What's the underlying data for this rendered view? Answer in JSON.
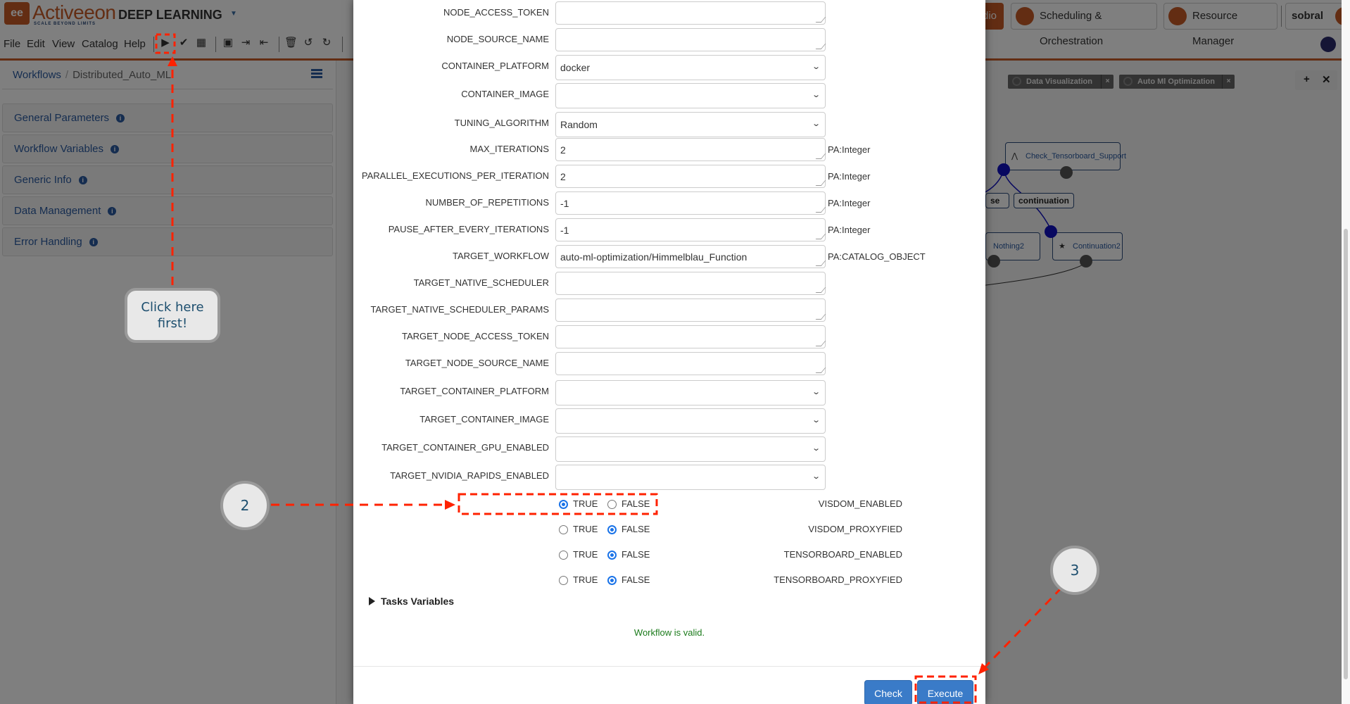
{
  "header": {
    "brand": "Activeeon",
    "brand_tagline": "SCALE BEYOND LIMITS",
    "app_title": "DEEP LEARNING",
    "studio_label": "dio",
    "portals": [
      {
        "label": "Scheduling & Orchestration",
        "icon": "gears-icon"
      },
      {
        "label": "Resource Manager",
        "icon": "cloud-icon"
      }
    ],
    "user": "sobral"
  },
  "menu": [
    "File",
    "Edit",
    "View",
    "Catalog",
    "Help"
  ],
  "toolbar_icons": [
    "play-icon",
    "check-icon",
    "calendar-icon",
    "save-icon",
    "import-icon",
    "export-icon",
    "trash-icon",
    "undo-icon",
    "redo-icon"
  ],
  "sidebar": {
    "breadcrumb": {
      "root": "Workflows",
      "current": "Distributed_Auto_ML"
    },
    "panels": [
      "General Parameters",
      "Workflow Variables",
      "Generic Info",
      "Data Management",
      "Error Handling"
    ]
  },
  "graph": {
    "tabs": [
      "Data Visualization",
      "Auto Ml Optimization"
    ],
    "tools": [
      "+",
      "✕"
    ],
    "nodes": [
      "Check_Tensorboard_Support",
      "Nothing2",
      "Continuation2"
    ],
    "edge_labels": [
      "se",
      "continuation"
    ]
  },
  "modal": {
    "fields": [
      {
        "name": "NODE_ACCESS_TOKEN",
        "type": "textarea",
        "value": "",
        "hint": ""
      },
      {
        "name": "NODE_SOURCE_NAME",
        "type": "textarea",
        "value": "",
        "hint": ""
      },
      {
        "name": "CONTAINER_PLATFORM",
        "type": "select",
        "value": "docker",
        "hint": ""
      },
      {
        "name": "CONTAINER_IMAGE",
        "type": "select",
        "value": "",
        "hint": ""
      },
      {
        "name": "TUNING_ALGORITHM",
        "type": "select",
        "value": "Random",
        "hint": ""
      },
      {
        "name": "MAX_ITERATIONS",
        "type": "textarea",
        "value": "2",
        "hint": "PA:Integer"
      },
      {
        "name": "PARALLEL_EXECUTIONS_PER_ITERATION",
        "type": "textarea",
        "value": "2",
        "hint": "PA:Integer"
      },
      {
        "name": "NUMBER_OF_REPETITIONS",
        "type": "textarea",
        "value": "-1",
        "hint": "PA:Integer"
      },
      {
        "name": "PAUSE_AFTER_EVERY_ITERATIONS",
        "type": "textarea",
        "value": "-1",
        "hint": "PA:Integer"
      },
      {
        "name": "TARGET_WORKFLOW",
        "type": "textarea",
        "value": "auto-ml-optimization/Himmelblau_Function",
        "hint": "PA:CATALOG_OBJECT"
      },
      {
        "name": "TARGET_NATIVE_SCHEDULER",
        "type": "textarea",
        "value": "",
        "hint": ""
      },
      {
        "name": "TARGET_NATIVE_SCHEDULER_PARAMS",
        "type": "textarea",
        "value": "",
        "hint": ""
      },
      {
        "name": "TARGET_NODE_ACCESS_TOKEN",
        "type": "textarea",
        "value": "",
        "hint": ""
      },
      {
        "name": "TARGET_NODE_SOURCE_NAME",
        "type": "textarea",
        "value": "",
        "hint": ""
      },
      {
        "name": "TARGET_CONTAINER_PLATFORM",
        "type": "select",
        "value": "",
        "hint": ""
      },
      {
        "name": "TARGET_CONTAINER_IMAGE",
        "type": "select",
        "value": "",
        "hint": ""
      },
      {
        "name": "TARGET_CONTAINER_GPU_ENABLED",
        "type": "select",
        "value": "",
        "hint": ""
      },
      {
        "name": "TARGET_NVIDIA_RAPIDS_ENABLED",
        "type": "select",
        "value": "",
        "hint": ""
      }
    ],
    "radios": [
      {
        "name": "VISDOM_ENABLED",
        "value": "TRUE"
      },
      {
        "name": "VISDOM_PROXYFIED",
        "value": "FALSE"
      },
      {
        "name": "TENSORBOARD_ENABLED",
        "value": "FALSE"
      },
      {
        "name": "TENSORBOARD_PROXYFIED",
        "value": "FALSE"
      }
    ],
    "radio_options": [
      "TRUE",
      "FALSE"
    ],
    "tasks_variables_label": "Tasks Variables",
    "status": "Workflow is valid.",
    "check_label": "Check",
    "execute_label": "Execute"
  },
  "annotations": {
    "step1": "Click here first!",
    "step2": "2",
    "step3": "3"
  },
  "colors": {
    "brand": "#c75b26",
    "primary_button": "#3a7bc8",
    "radio_selected": "#1a73e8",
    "valid_text": "#1a7a1a",
    "annotation": "#ff2200"
  }
}
